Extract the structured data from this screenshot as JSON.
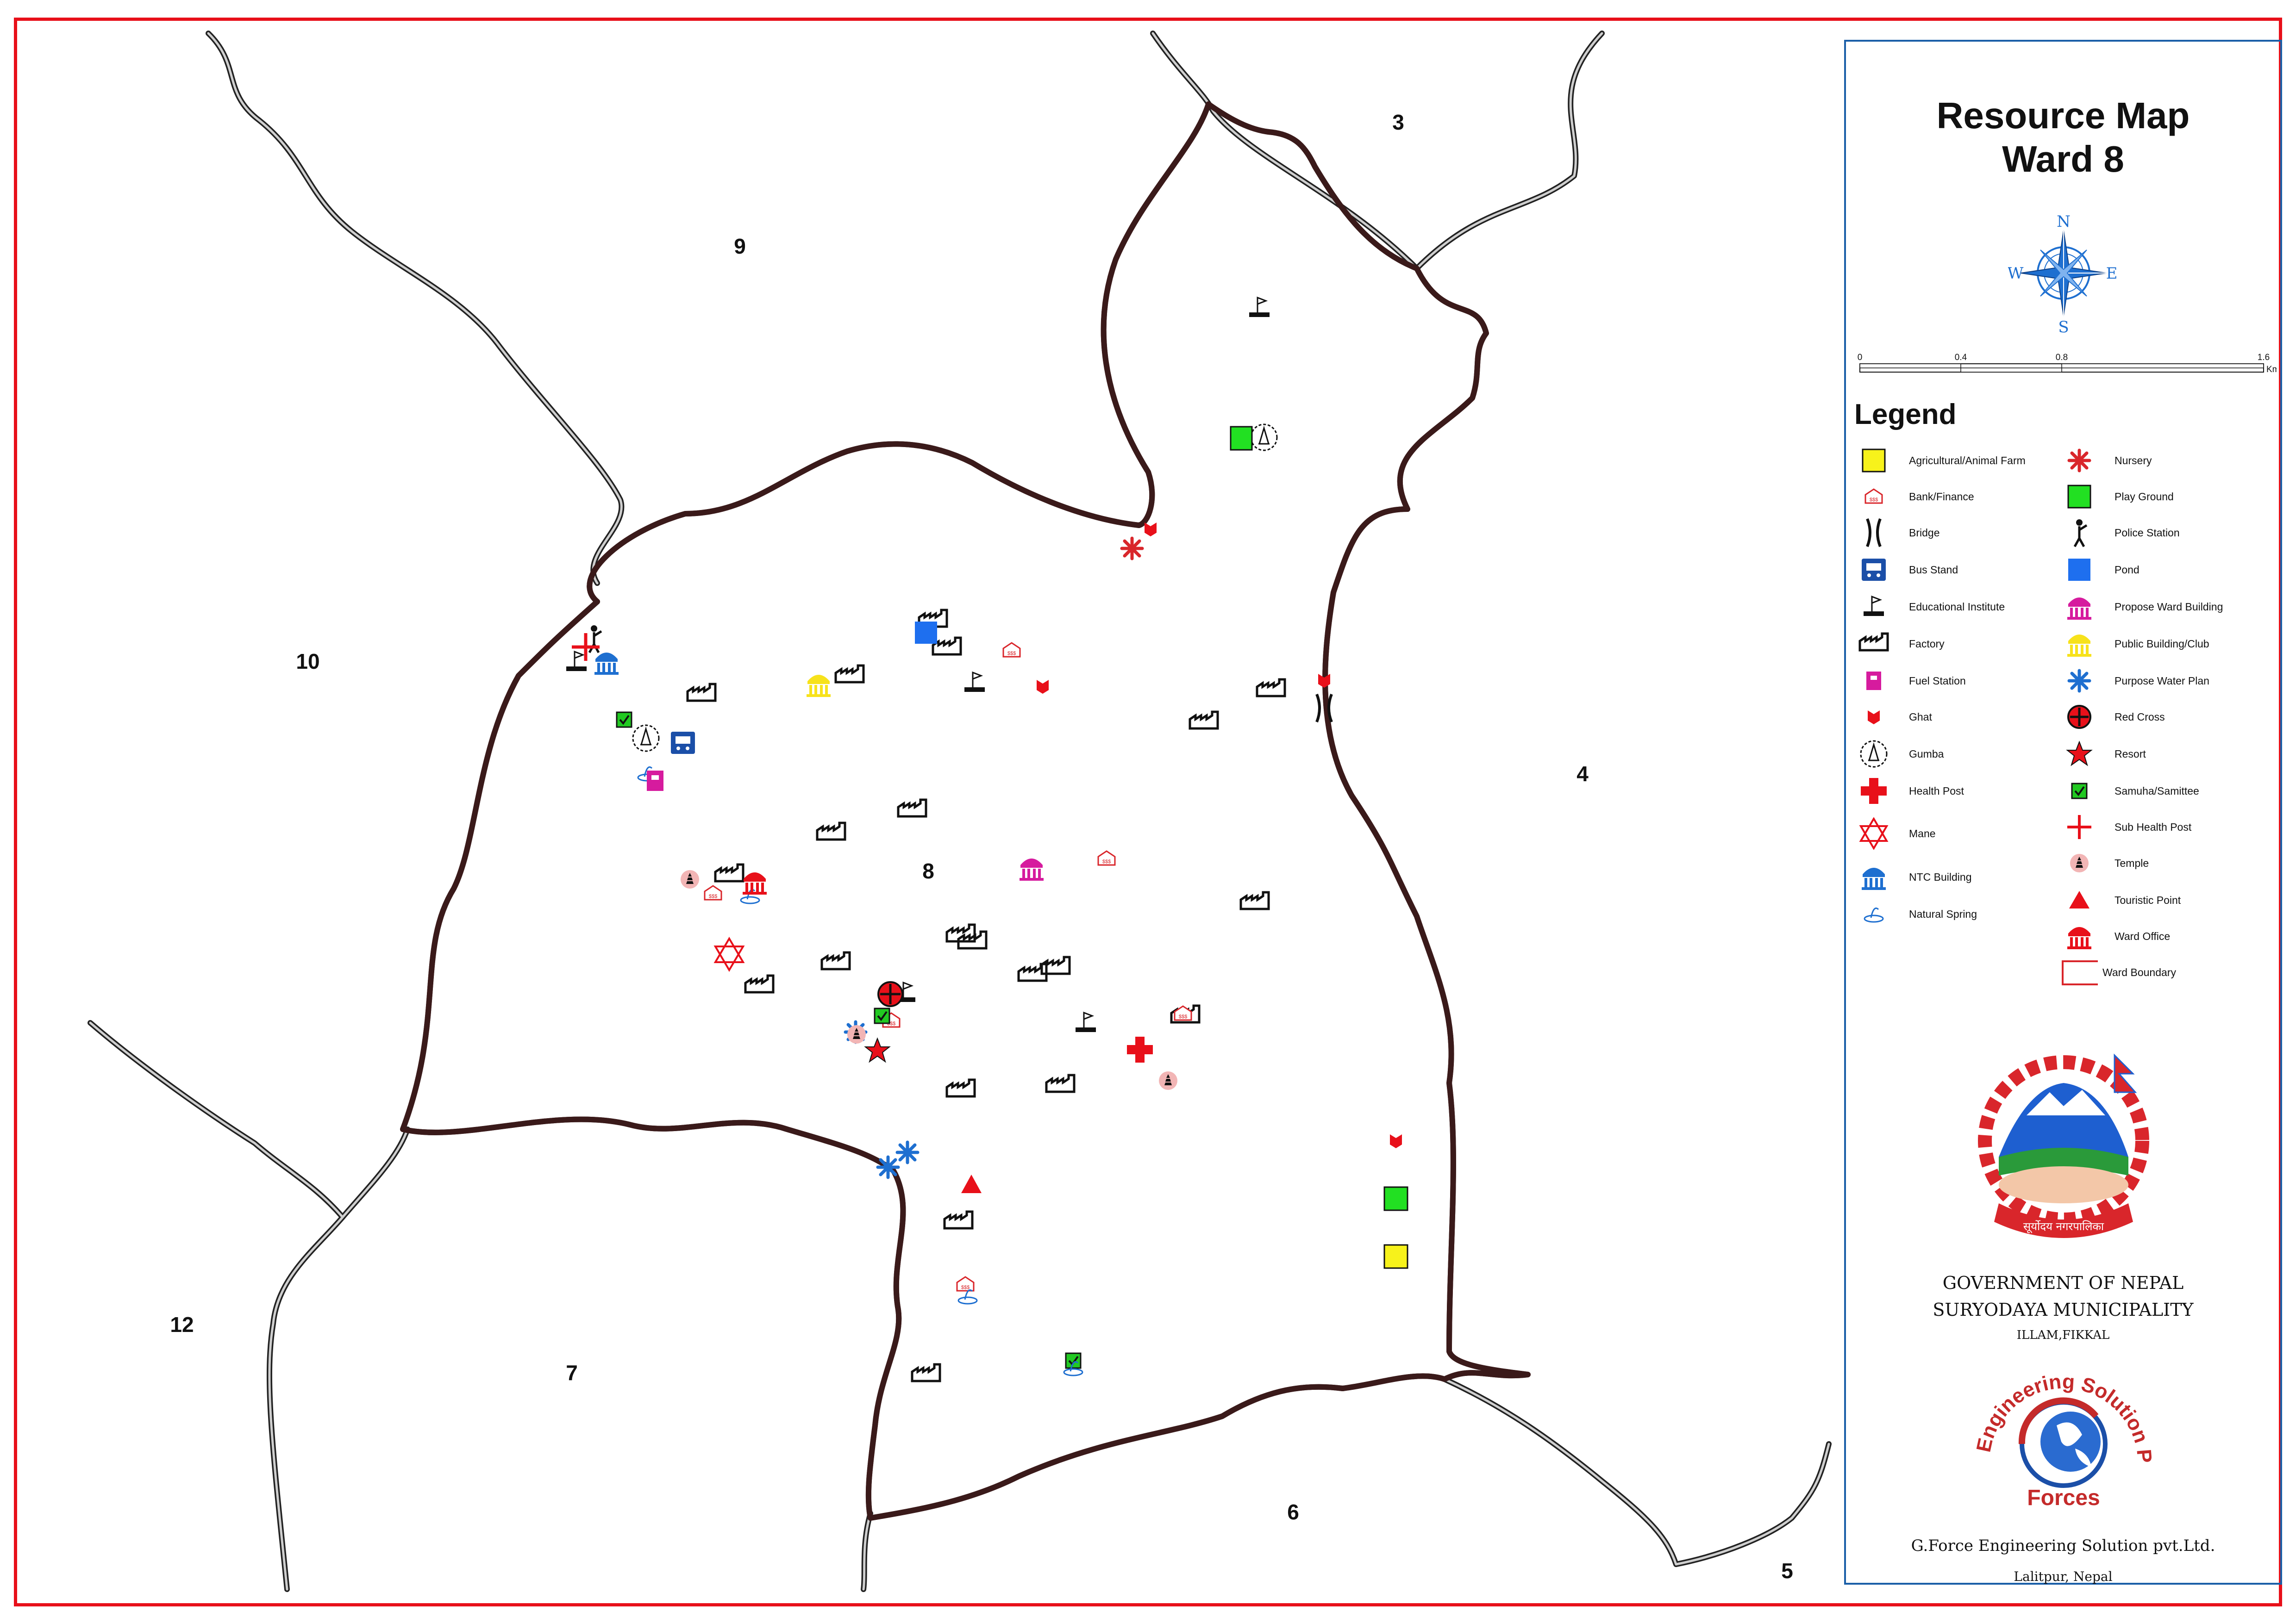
{
  "title_line1": "Resource Map",
  "title_line2": "Ward 8",
  "compass": {
    "n": "N",
    "s": "S",
    "e": "E",
    "w": "W"
  },
  "scalebar": {
    "ticks": [
      "0",
      "0.4",
      "0.8",
      "1.6"
    ],
    "unit": "Km"
  },
  "legend_title": "Legend",
  "legend_left": [
    {
      "label": "Agricultural/Animal Farm",
      "icon": "farm-icon"
    },
    {
      "label": "Bank/Finance",
      "icon": "bank-icon"
    },
    {
      "label": "Bridge",
      "icon": "bridge-icon"
    },
    {
      "label": "Bus Stand",
      "icon": "bus-stand-icon"
    },
    {
      "label": "Educational Institute",
      "icon": "school-flag-icon"
    },
    {
      "label": "Factory",
      "icon": "factory-icon"
    },
    {
      "label": "Fuel Station",
      "icon": "fuel-station-icon"
    },
    {
      "label": "Ghat",
      "icon": "ghat-icon"
    },
    {
      "label": "Gumba",
      "icon": "gumba-icon"
    },
    {
      "label": "Health Post",
      "icon": "health-post-icon"
    },
    {
      "label": "Mane",
      "icon": "mane-star-icon"
    },
    {
      "label": "NTC Building",
      "icon": "ntc-building-icon"
    },
    {
      "label": "Natural Spring",
      "icon": "spring-icon"
    }
  ],
  "legend_right": [
    {
      "label": "Nursery",
      "icon": "nursery-icon"
    },
    {
      "label": "Play Ground",
      "icon": "playground-icon"
    },
    {
      "label": "Police Station",
      "icon": "police-icon"
    },
    {
      "label": "Pond",
      "icon": "pond-icon"
    },
    {
      "label": "Propose Ward Building",
      "icon": "proposed-ward-building-icon"
    },
    {
      "label": "Public Building/Club",
      "icon": "public-building-icon"
    },
    {
      "label": "Purpose Water Plan",
      "icon": "water-plan-icon"
    },
    {
      "label": "Red Cross",
      "icon": "red-cross-icon"
    },
    {
      "label": "Resort",
      "icon": "resort-star-icon"
    },
    {
      "label": "Samuha/Samittee",
      "icon": "samuha-icon"
    },
    {
      "label": "Sub Health Post",
      "icon": "sub-health-post-icon"
    },
    {
      "label": "Temple",
      "icon": "temple-icon"
    },
    {
      "label": "Touristic Point",
      "icon": "touristic-point-icon"
    },
    {
      "label": "Ward Office",
      "icon": "ward-office-icon"
    },
    {
      "label": "Ward Boundary",
      "icon": "ward-boundary-icon"
    }
  ],
  "ward_labels": [
    "3",
    "9",
    "10",
    "4",
    "8",
    "12",
    "7",
    "6",
    "5"
  ],
  "org": {
    "gov": "GOVERNMENT OF NEPAL",
    "muni": "SURYODAYA MUNICIPALITY",
    "place": "ILLAM,FIKKAL",
    "emblem_text": "सूर्योदय नगरपालिका",
    "consultant_logo_top": "Engineering Solution Pvt. Ltd.",
    "consultant_logo_bottom": "Forces",
    "consultant": "G.Force Engineering Solution pvt.Ltd.",
    "consultant_place": "Lalitpur, Nepal"
  },
  "colors": {
    "frame": "#e8101a",
    "ward_boundary": "#d9262b",
    "road_casing": "#222222",
    "panel_border": "#1b5fa8",
    "compass": "#1e6fd0"
  }
}
